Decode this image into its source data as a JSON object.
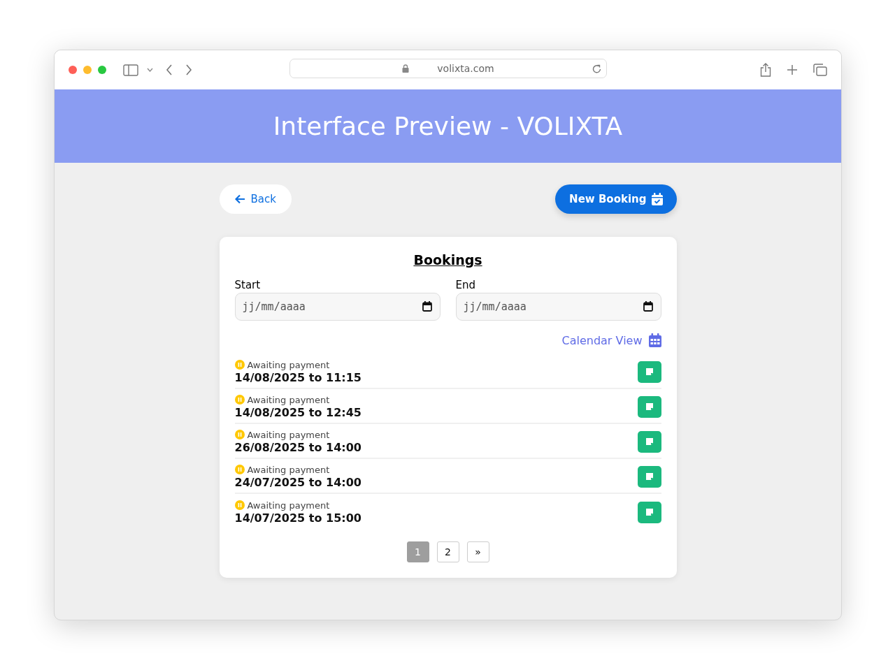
{
  "browser": {
    "url": "volixta.com"
  },
  "header": {
    "title": "Interface Preview - VOLIXTA"
  },
  "actions": {
    "back": "Back",
    "new_booking": "New Booking"
  },
  "bookings": {
    "title": "Bookings",
    "filters": [
      {
        "label": "Start",
        "placeholder": "jj/mm/aaaa"
      },
      {
        "label": "End",
        "placeholder": "jj/mm/aaaa"
      }
    ],
    "calendar_link": "Calendar View",
    "rows": [
      {
        "status": "Awaiting payment",
        "when": "14/08/2025 to 11:15"
      },
      {
        "status": "Awaiting payment",
        "when": "14/08/2025 to 12:45"
      },
      {
        "status": "Awaiting payment",
        "when": "26/08/2025 to 14:00"
      },
      {
        "status": "Awaiting payment",
        "when": "24/07/2025 to 14:00"
      },
      {
        "status": "Awaiting payment",
        "when": "14/07/2025 to 15:00"
      }
    ],
    "pagination": [
      {
        "label": "1",
        "selected": true
      },
      {
        "label": "2",
        "selected": false
      },
      {
        "label": "»",
        "selected": false
      }
    ]
  }
}
